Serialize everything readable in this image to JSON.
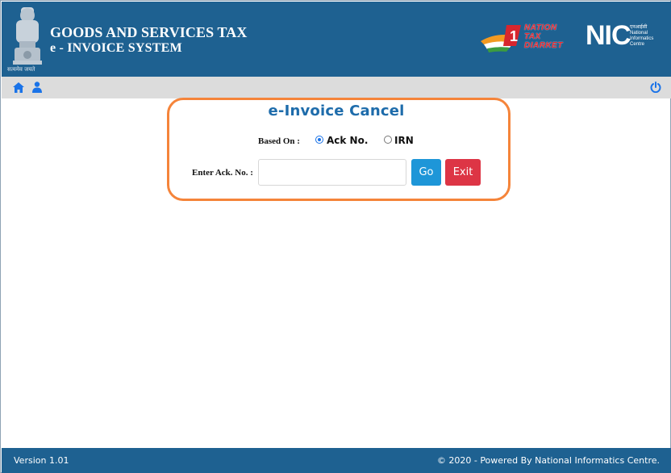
{
  "header": {
    "emblem_caption": "सत्यमेव जयते",
    "title_line1": "GOODS AND SERVICES TAX",
    "title_line2": "e - INVOICE SYSTEM",
    "ntd_logo_text": [
      "NATION",
      "TAX",
      "DIARKET"
    ],
    "nic_letters": "NIC",
    "nic_subtitle": [
      "एनआईसी",
      "National",
      "Informatics",
      "Centre"
    ]
  },
  "navbar": {
    "home_icon": "home-icon",
    "user_icon": "user-icon",
    "power_icon": "power-icon"
  },
  "form": {
    "title": "e-Invoice Cancel",
    "based_on_label": "Based On :",
    "options": [
      {
        "label": "Ack No.",
        "selected": true
      },
      {
        "label": "IRN",
        "selected": false
      }
    ],
    "ack_label": "Enter Ack. No. :",
    "ack_value": "",
    "go_label": "Go",
    "exit_label": "Exit"
  },
  "footer": {
    "version": "Version 1.01",
    "copyright": "© 2020 - Powered By National Informatics Centre."
  },
  "colors": {
    "header_bg": "#1e6191",
    "title_blue": "#1e6cab",
    "highlight_orange": "#f5843a",
    "go_button": "#1e96d8",
    "exit_button": "#dd3545"
  }
}
